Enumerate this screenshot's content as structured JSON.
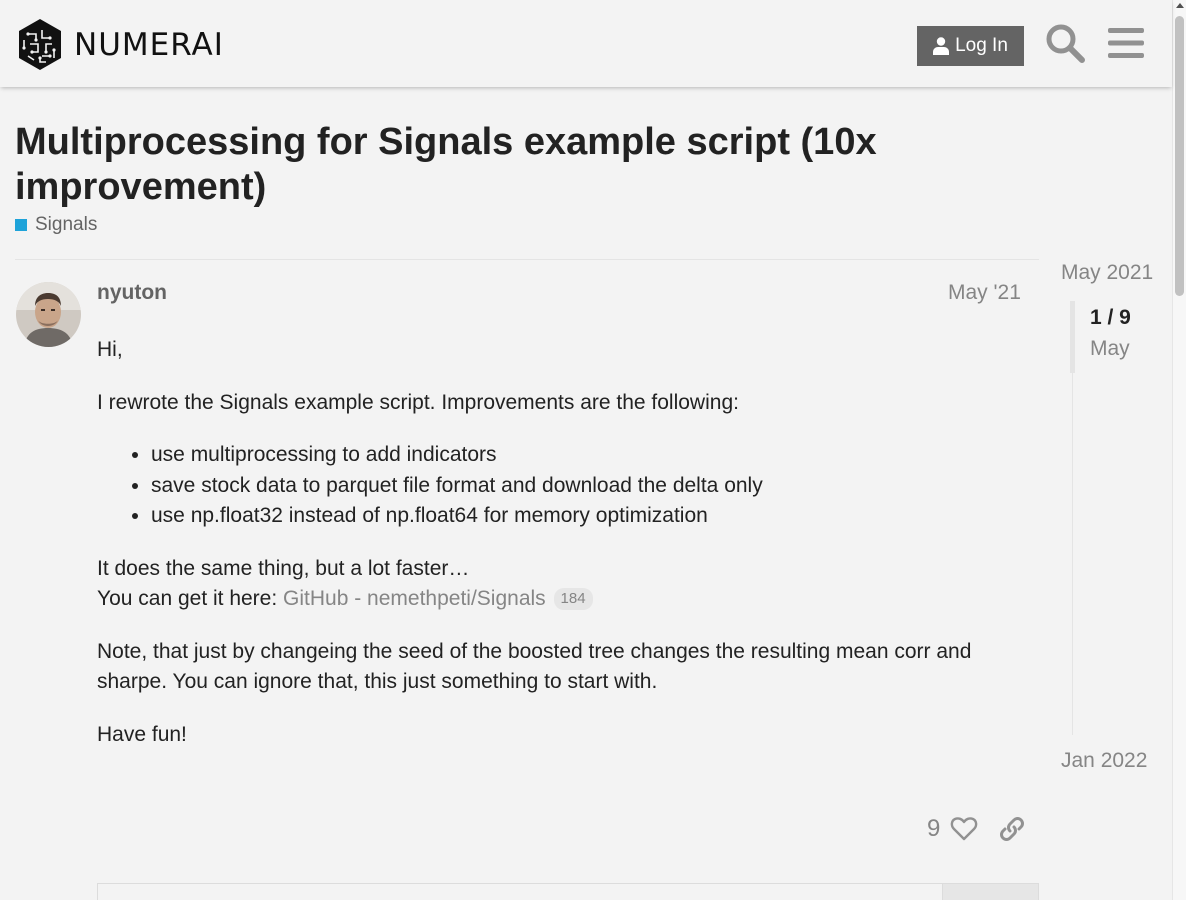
{
  "header": {
    "logo_text": "NUMERAI",
    "login_label": "Log In"
  },
  "topic": {
    "title": "Multiprocessing for Signals example script (10x improvement)",
    "category": "Signals",
    "category_color": "#1ea3d9"
  },
  "post": {
    "username": "nyuton",
    "date": "May '21",
    "greeting": "Hi,",
    "intro": "I rewrote the Signals example script. Improvements are the following:",
    "improvements": [
      "use multiprocessing to add indicators",
      "save stock data to parquet file format and download the delta only",
      "use np.float32 instead of np.float64 for memory optimization"
    ],
    "same_thing": "It does the same thing, but a lot faster…",
    "get_it_prefix": "You can get it here: ",
    "link_text": "GitHub - nemethpeti/Signals",
    "link_clicks": "184",
    "note": "Note, that just by changeing the seed of the boosted tree changes the resulting mean corr and sharpe. You can ignore that, this just something to start with.",
    "closing": "Have fun!",
    "like_count": "9"
  },
  "timeline": {
    "start": "May 2021",
    "counter": "1 / 9",
    "current_month": "May",
    "end": "Jan 2022"
  }
}
